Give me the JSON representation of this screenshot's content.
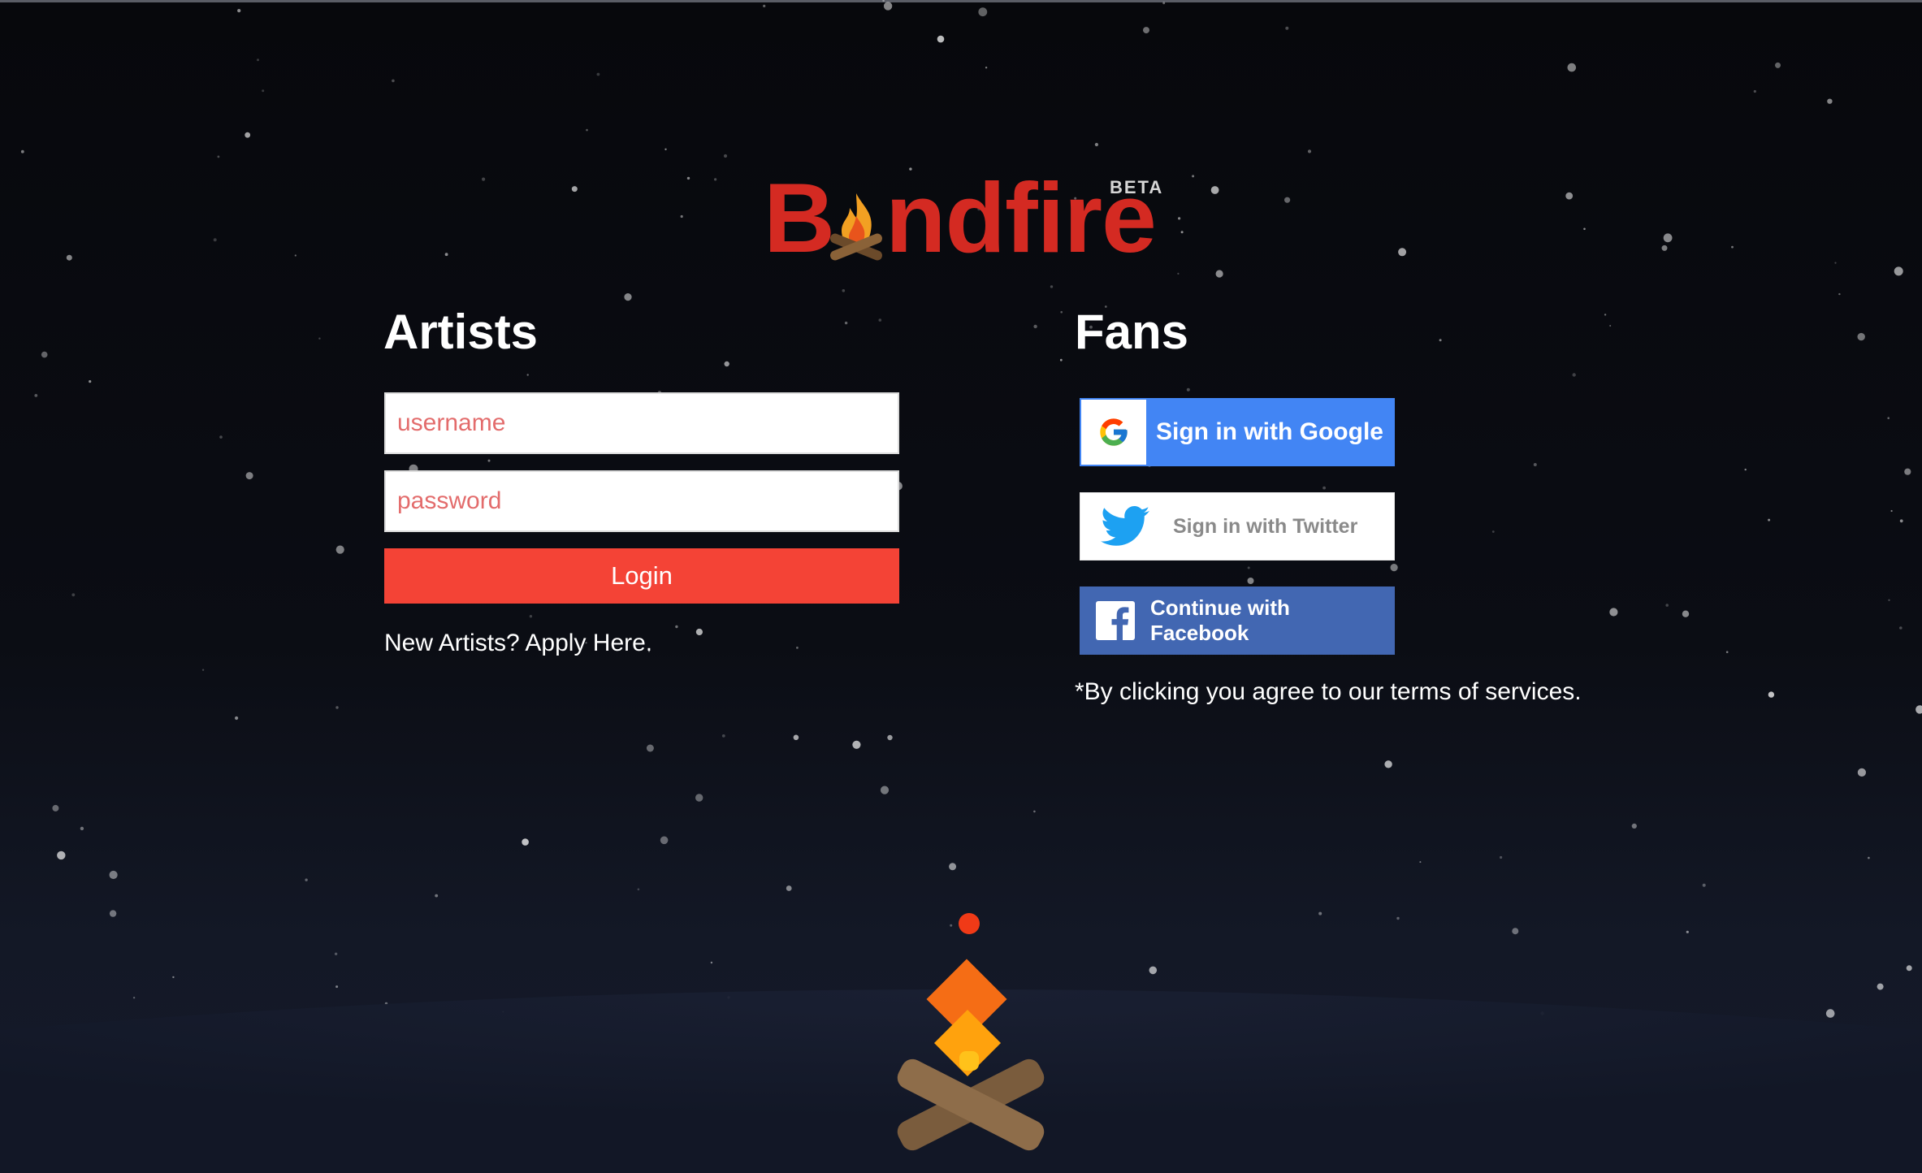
{
  "logo": {
    "first_letter": "B",
    "rest": "ndfire",
    "beta": "BETA",
    "colors": {
      "brand": "#d42a22",
      "beta": "#d6d6d6"
    }
  },
  "artists": {
    "heading": "Artists",
    "username_placeholder": "username",
    "password_placeholder": "password",
    "login_label": "Login",
    "apply_link": "New Artists? Apply Here."
  },
  "fans": {
    "heading": "Fans",
    "google_label": "Sign in with Google",
    "twitter_label": "Sign in with Twitter",
    "facebook_label": "Continue with Facebook",
    "terms": "*By clicking you agree to our terms of services."
  },
  "icons": {
    "logo_fire": "campfire-icon",
    "google": "google-g-icon",
    "twitter": "twitter-bird-icon",
    "facebook": "facebook-f-icon",
    "illustration": "campfire-illustration"
  },
  "colors": {
    "background": "#0a0b10",
    "login_button": "#f44336",
    "google_blue": "#4285f4",
    "facebook_blue": "#4267b2",
    "twitter_blue": "#1da1f2",
    "placeholder": "#e36c6c"
  }
}
